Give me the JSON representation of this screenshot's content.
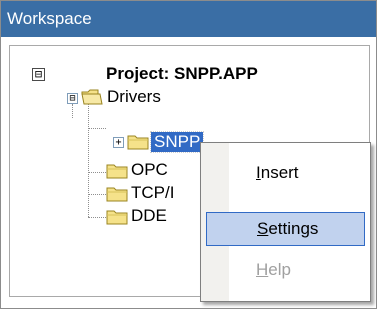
{
  "window": {
    "title": "Workspace"
  },
  "tree": {
    "root": {
      "label": "Project: SNPP.APP",
      "expander": "⊟"
    },
    "drivers": {
      "label": "Drivers",
      "expander": "⊟"
    },
    "snpp": {
      "label": "SNPP",
      "expander": "+"
    },
    "opc": {
      "label": "OPC"
    },
    "tcp": {
      "label": "TCP/I"
    },
    "dde": {
      "label": "DDE"
    }
  },
  "menu": {
    "insert": {
      "accel": "I",
      "rest": "nsert"
    },
    "settings": {
      "accel": "S",
      "rest": "ettings"
    },
    "help": {
      "accel": "H",
      "rest": "elp"
    }
  },
  "colors": {
    "titlebar": "#3a6ea5",
    "selection": "#316ac5",
    "menu_hover": "#c1d2ee",
    "folder_fill": "#f5e28a",
    "folder_edge": "#9a8420"
  },
  "icons": {
    "folder": "folder-icon",
    "open_folder": "open-folder-icon",
    "expand": "plus-box-icon",
    "collapse": "minus-box-icon"
  }
}
